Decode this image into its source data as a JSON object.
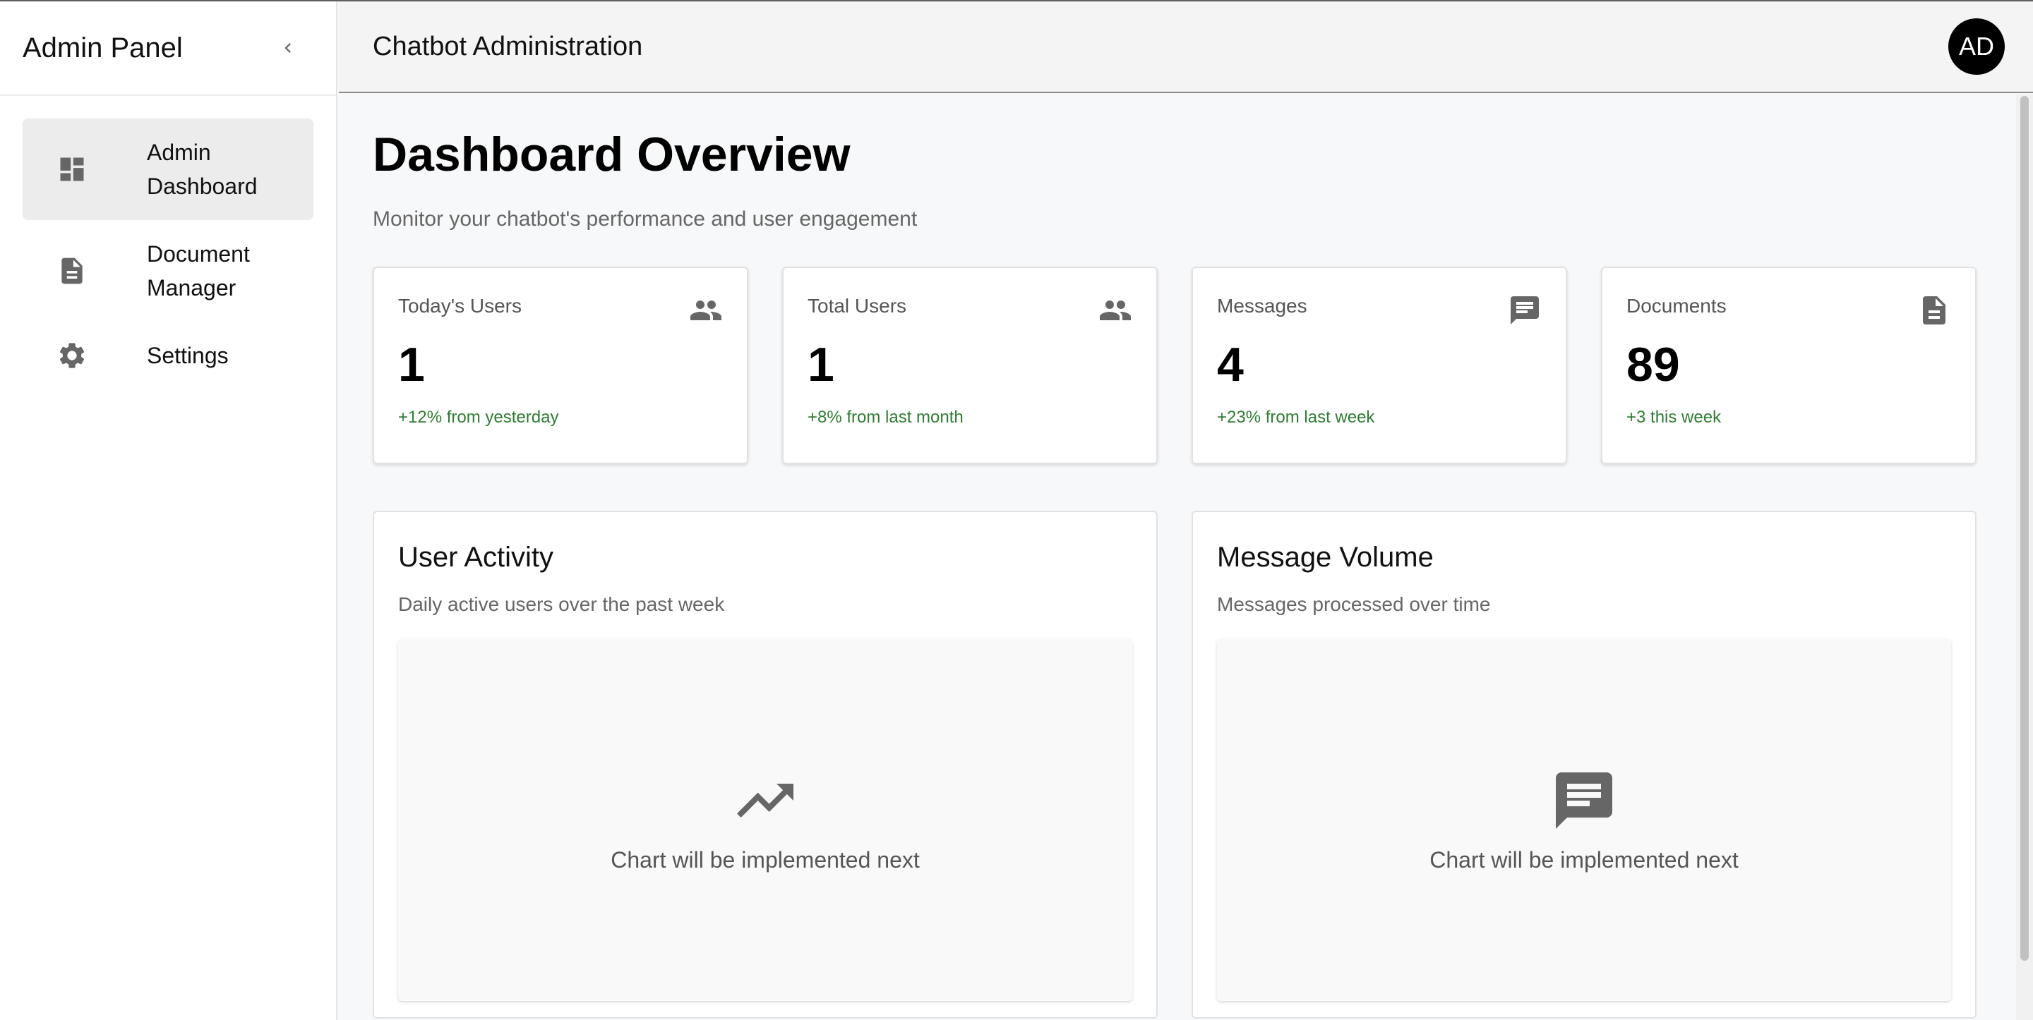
{
  "sidebar": {
    "title": "Admin Panel",
    "items": [
      {
        "label": "Admin Dashboard",
        "icon": "dashboard-icon",
        "active": true
      },
      {
        "label": "Document Manager",
        "icon": "document-icon",
        "active": false
      },
      {
        "label": "Settings",
        "icon": "gear-icon",
        "active": false
      }
    ]
  },
  "header": {
    "title": "Chatbot Administration",
    "avatar_initials": "AD"
  },
  "main": {
    "title": "Dashboard Overview",
    "subtitle": "Monitor your chatbot's performance and user engagement",
    "stats": [
      {
        "label": "Today's Users",
        "value": "1",
        "change": "+12% from yesterday",
        "icon": "people-icon"
      },
      {
        "label": "Total Users",
        "value": "1",
        "change": "+8% from last month",
        "icon": "people-icon"
      },
      {
        "label": "Messages",
        "value": "4",
        "change": "+23% from last week",
        "icon": "message-icon"
      },
      {
        "label": "Documents",
        "value": "89",
        "change": "+3 this week",
        "icon": "document-icon"
      }
    ],
    "charts": [
      {
        "title": "User Activity",
        "subtitle": "Daily active users over the past week",
        "placeholder": "Chart will be implemented next",
        "icon": "trending-up-icon"
      },
      {
        "title": "Message Volume",
        "subtitle": "Messages processed over time",
        "placeholder": "Chart will be implemented next",
        "icon": "message-icon"
      }
    ]
  },
  "colors": {
    "positive_change": "#2e7d32",
    "icon_gray": "#666666",
    "active_nav_bg": "#ececec"
  }
}
